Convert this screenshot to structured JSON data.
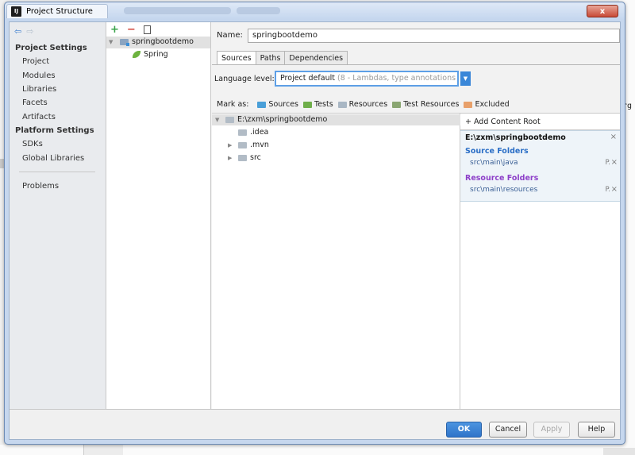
{
  "window": {
    "title": "Project Structure",
    "close_label": "x"
  },
  "background": {
    "code_fragment": "rg"
  },
  "nav": {
    "back_icon": "arrow-left-icon",
    "forward_icon": "arrow-right-icon",
    "project_settings_header": "Project Settings",
    "project_settings": [
      "Project",
      "Modules",
      "Libraries",
      "Facets",
      "Artifacts"
    ],
    "platform_settings_header": "Platform Settings",
    "platform_settings": [
      "SDKs",
      "Global Libraries"
    ],
    "problems": "Problems"
  },
  "module_tree": {
    "toolbar": {
      "add": "+",
      "remove": "−"
    },
    "root": "springbootdemo",
    "child": "Spring"
  },
  "module_config": {
    "name_label": "Name:",
    "name_value": "springbootdemo",
    "tabs": [
      "Sources",
      "Paths",
      "Dependencies"
    ],
    "active_tab": "Sources",
    "language_level_label": "Language level:",
    "language_level_value": "Project default",
    "language_level_hint": "(8 - Lambdas, type annotations etc.)",
    "mark_as_label": "Mark as:",
    "mark_as": [
      {
        "label": "Sources",
        "color": "#4a9fd8"
      },
      {
        "label": "Tests",
        "color": "#6fae4a"
      },
      {
        "label": "Resources",
        "color": "#a9b7c4"
      },
      {
        "label": "Test Resources",
        "color": "#8aa672"
      },
      {
        "label": "Excluded",
        "color": "#e8a06a"
      }
    ]
  },
  "content_tree": {
    "root": "E:\\zxm\\springbootdemo",
    "children": [
      ".idea",
      ".mvn",
      "src"
    ]
  },
  "content_roots": {
    "add_label": "+ Add Content Root",
    "root_path": "E:\\zxm\\springbootdemo",
    "source_folders_title": "Source Folders",
    "source_folders_color": "#2a6ec6",
    "source_folders": [
      "src\\main\\java"
    ],
    "resource_folders_title": "Resource Folders",
    "resource_folders_color": "#8d3fc9",
    "resource_folders": [
      "src\\main\\resources"
    ],
    "folder_action": "P.",
    "remove_action": "×"
  },
  "footer": {
    "ok": "OK",
    "cancel": "Cancel",
    "apply": "Apply",
    "help": "Help"
  }
}
